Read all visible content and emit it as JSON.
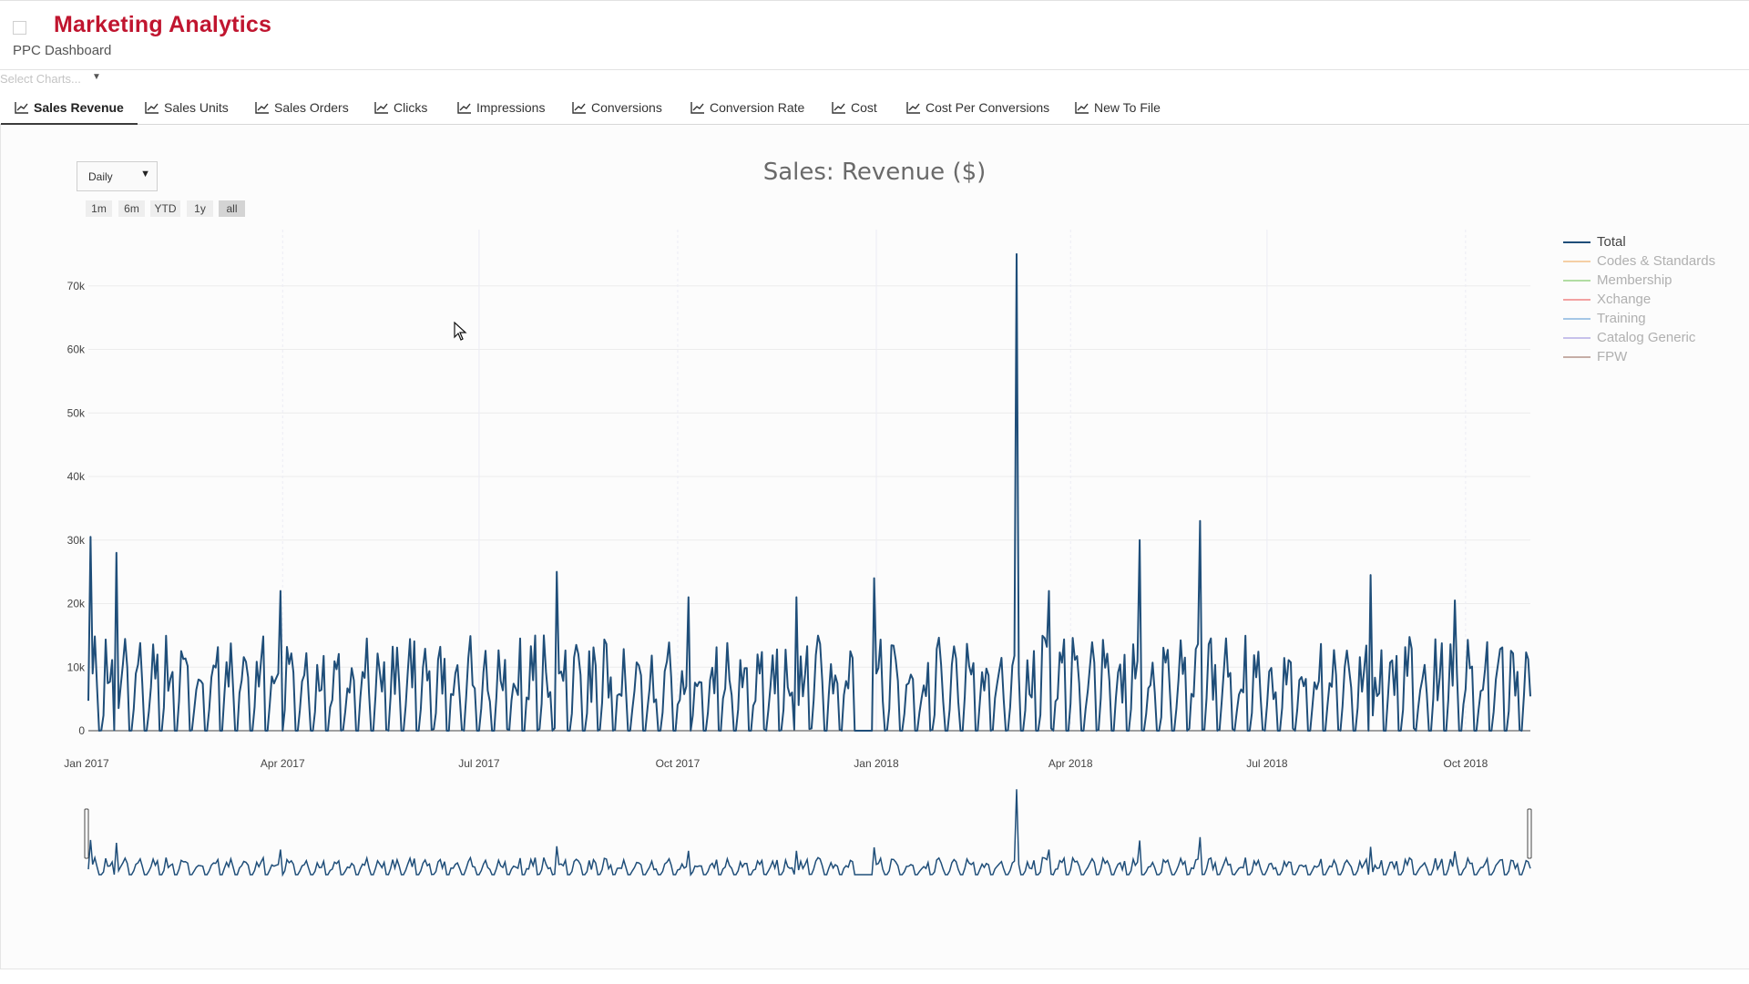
{
  "header": {
    "title": "Marketing Analytics",
    "subtitle": "PPC Dashboard"
  },
  "select_charts": {
    "placeholder": "Select Charts..."
  },
  "tabs": [
    {
      "label": "Sales Revenue",
      "active": true
    },
    {
      "label": "Sales Units"
    },
    {
      "label": "Sales Orders"
    },
    {
      "label": "Clicks"
    },
    {
      "label": "Impressions"
    },
    {
      "label": "Conversions"
    },
    {
      "label": "Conversion Rate"
    },
    {
      "label": "Cost"
    },
    {
      "label": "Cost Per Conversions"
    },
    {
      "label": "New To File"
    }
  ],
  "controls": {
    "frequency": "Daily",
    "range_buttons": [
      "1m",
      "6m",
      "YTD",
      "1y",
      "all"
    ],
    "active_range": "all"
  },
  "colors": {
    "brand": "#c0152f",
    "total_line": "#1f4e79",
    "legend_active_text": "#444444",
    "legend_inactive_text": "#b0b0b0"
  },
  "chart_data": {
    "type": "line",
    "title": "Sales: Revenue ($)",
    "xlabel": "",
    "ylabel": "",
    "x_ticks": [
      "Jan 2017",
      "Apr 2017",
      "Jul 2017",
      "Oct 2017",
      "Jan 2018",
      "Apr 2018",
      "Jul 2018",
      "Oct 2018"
    ],
    "y_ticks": [
      "0",
      "10k",
      "20k",
      "30k",
      "40k",
      "50k",
      "60k",
      "70k"
    ],
    "xlim": [
      "2017-01-01",
      "2018-10-31"
    ],
    "ylim": [
      0,
      78000
    ],
    "grid": true,
    "legend_position": "right",
    "range_slider": true,
    "series": [
      {
        "name": "Total",
        "color": "#1f4e79",
        "visible": true
      },
      {
        "name": "Codes & Standards",
        "color": "#f2c38f",
        "visible": false
      },
      {
        "name": "Membership",
        "color": "#9ed48c",
        "visible": false
      },
      {
        "name": "Xchange",
        "color": "#f08a8a",
        "visible": false
      },
      {
        "name": "Training",
        "color": "#8fb9e0",
        "visible": false
      },
      {
        "name": "Catalog Generic",
        "color": "#b9b2e6",
        "visible": false
      },
      {
        "name": "FPW",
        "color": "#b89a90",
        "visible": false
      }
    ],
    "typical_daily_peak_range": [
      8000,
      15000
    ],
    "notable_points": [
      {
        "x": "2017-01-02",
        "y": 30500
      },
      {
        "x": "2017-01-14",
        "y": 28000
      },
      {
        "x": "2017-03-31",
        "y": 22000
      },
      {
        "x": "2017-08-06",
        "y": 25000
      },
      {
        "x": "2017-10-06",
        "y": 21000
      },
      {
        "x": "2017-11-25",
        "y": 21000
      },
      {
        "x": "2017-12-31",
        "y": 24000
      },
      {
        "x": "2018-03-07",
        "y": 75000
      },
      {
        "x": "2018-03-22",
        "y": 22000
      },
      {
        "x": "2018-05-03",
        "y": 30000
      },
      {
        "x": "2018-05-31",
        "y": 33000
      },
      {
        "x": "2018-08-18",
        "y": 24500
      },
      {
        "x": "2018-09-26",
        "y": 20500
      }
    ]
  }
}
